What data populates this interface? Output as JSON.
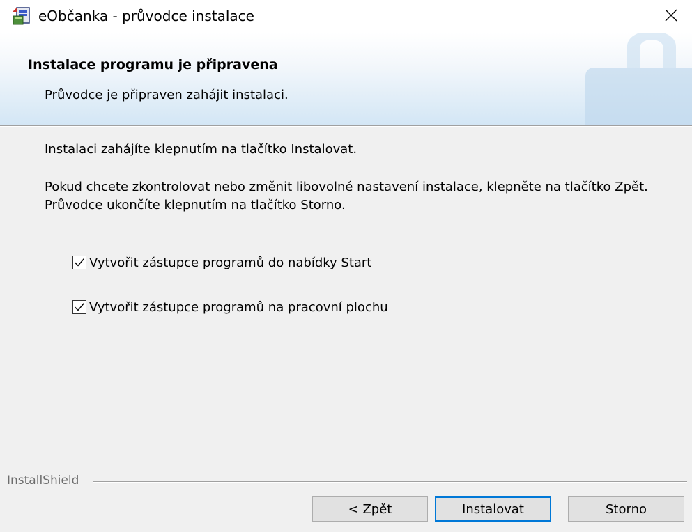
{
  "window": {
    "title": "eObčanka - průvodce instalace"
  },
  "banner": {
    "title": "Instalace programu je připravena",
    "subtitle": "Průvodce je připraven zahájit instalaci."
  },
  "body": {
    "line1": "Instalaci zahájíte klepnutím na tlačítko Instalovat.",
    "paragraph": "Pokud chcete zkontrolovat nebo změnit libovolné nastavení instalace, klepněte na tlačítko Zpět. Průvodce ukončíte klepnutím na tlačítko Storno."
  },
  "options": [
    {
      "label": "Vytvořit zástupce programů do nabídky Start",
      "checked": true
    },
    {
      "label": "Vytvořit zástupce programů na pracovní plochu",
      "checked": true
    }
  ],
  "footer": {
    "brand": "InstallShield"
  },
  "buttons": {
    "back": "< Zpět",
    "install": "Instalovat",
    "cancel": "Storno"
  },
  "colors": {
    "accent": "#0078d7",
    "dialog_bg": "#f0f0f0",
    "banner_tint": "#d3e6f5"
  },
  "icons": {
    "app": "installer-icon",
    "close": "close-icon",
    "check": "checkmark-icon"
  }
}
